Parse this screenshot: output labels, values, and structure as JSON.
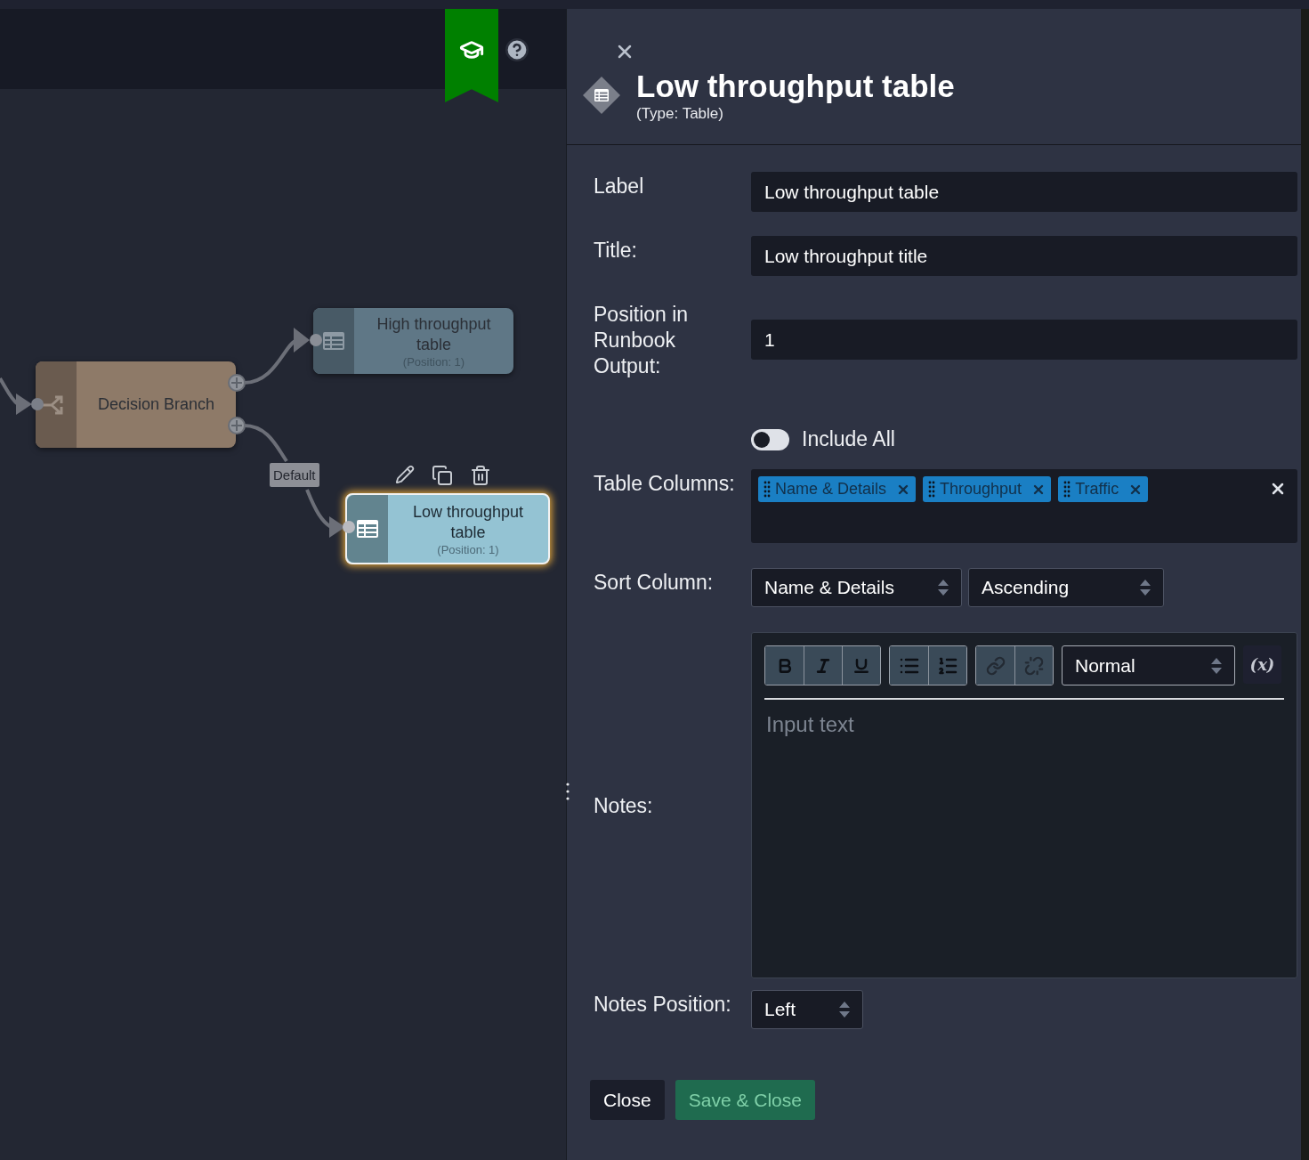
{
  "canvas": {
    "nodes": [
      {
        "kind": "decision",
        "label": "Decision Branch",
        "selected": false
      },
      {
        "kind": "table",
        "label": "High throughput table",
        "position": "(Position: 1)",
        "selected": false
      },
      {
        "kind": "table",
        "label": "Low throughput table",
        "position": "(Position: 1)",
        "selected": true
      }
    ],
    "edge_label": "Default"
  },
  "panel": {
    "title": "Low throughput table",
    "subtitle": "(Type: Table)",
    "fields": [
      {
        "kind": "text",
        "label": "Label",
        "value": "Low throughput table"
      },
      {
        "kind": "text",
        "label": "Title:",
        "value": "Low throughput title"
      },
      {
        "kind": "text",
        "label": "Position in Runbook Output:",
        "value": "1"
      }
    ],
    "include_all": {
      "label": "Include All",
      "on": false
    },
    "table_columns": {
      "label": "Table Columns:",
      "tags": [
        "Name & Details",
        "Throughput",
        "Traffic"
      ]
    },
    "sort": {
      "label": "Sort Column:",
      "column": "Name & Details",
      "order": "Ascending"
    },
    "notes": {
      "label": "Notes:",
      "format": "Normal",
      "variable_button": "(x)",
      "placeholder": "Input text"
    },
    "notes_position": {
      "label": "Notes Position:",
      "value": "Left"
    },
    "buttons": [
      {
        "label": "Close",
        "kind": "secondary",
        "disabled": false
      },
      {
        "label": "Save & Close",
        "kind": "primary",
        "disabled": true
      }
    ]
  }
}
